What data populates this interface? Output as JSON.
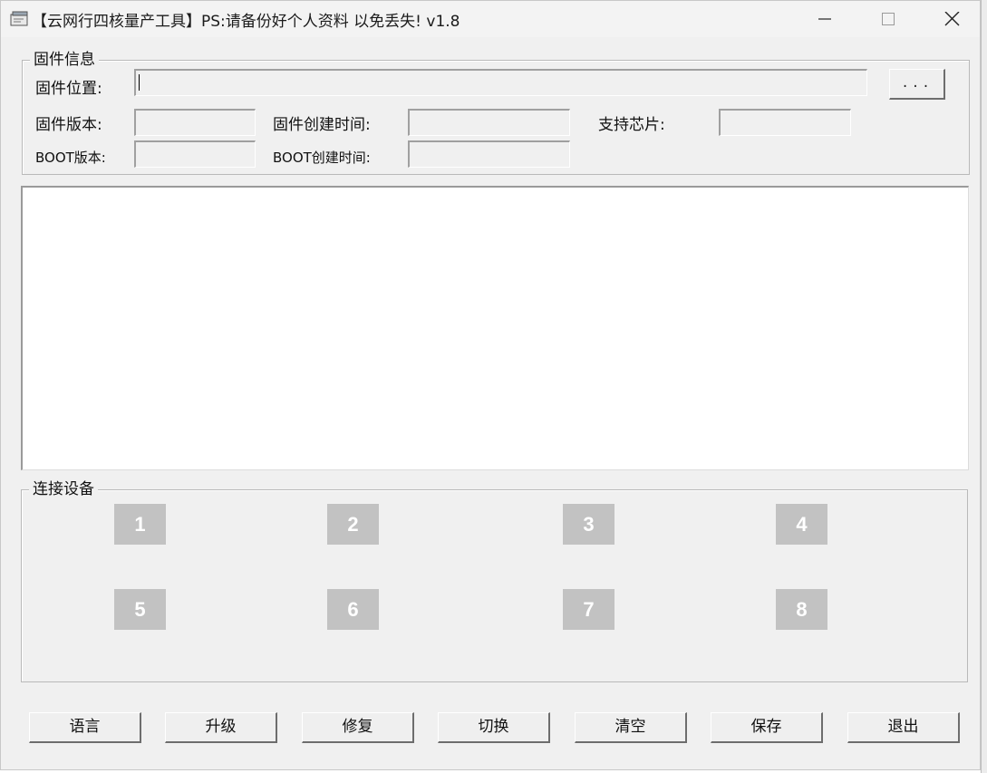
{
  "window": {
    "title": "【云网行四核量产工具】PS:请备份好个人资料 以免丢失!   v1.8"
  },
  "firmware": {
    "legend": "固件信息",
    "location_label": "固件位置:",
    "location_value": "",
    "browse_label": "...",
    "version_label": "固件版本:",
    "version_value": "",
    "created_label": "固件创建时间:",
    "created_value": "",
    "chip_label": "支持芯片:",
    "chip_value": "",
    "boot_version_label": "BOOT版本:",
    "boot_version_value": "",
    "boot_created_label": "BOOT创建时间:",
    "boot_created_value": ""
  },
  "log": {
    "content": ""
  },
  "devices": {
    "legend": "连接设备",
    "slots": [
      "1",
      "2",
      "3",
      "4",
      "5",
      "6",
      "7",
      "8"
    ]
  },
  "actions": {
    "language": "语言",
    "upgrade": "升级",
    "repair": "修复",
    "switch": "切换",
    "clear": "清空",
    "save": "保存",
    "exit": "退出"
  },
  "icons": {
    "app": "app-icon",
    "minimize": "minimize-icon",
    "maximize": "maximize-icon",
    "close": "close-icon"
  },
  "colors": {
    "window_bg": "#f0f0f0",
    "device_tile": "#c2c2c2"
  }
}
